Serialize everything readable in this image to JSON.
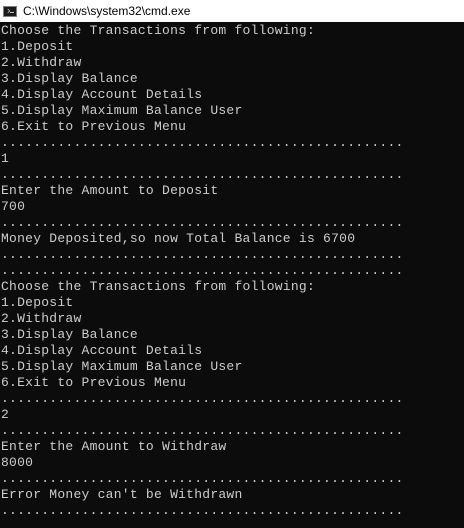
{
  "window": {
    "title": "C:\\Windows\\system32\\cmd.exe",
    "icon": "cmd-icon"
  },
  "console": {
    "lines": [
      "Choose the Transactions from following:",
      "1.Deposit",
      "2.Withdraw",
      "3.Display Balance",
      "4.Display Account Details",
      "5.Display Maximum Balance User",
      "6.Exit to Previous Menu",
      "..................................................",
      "1",
      "..................................................",
      "Enter the Amount to Deposit",
      "700",
      "..................................................",
      "Money Deposited,so now Total Balance is 6700",
      "..................................................",
      "..................................................",
      "Choose the Transactions from following:",
      "1.Deposit",
      "2.Withdraw",
      "3.Display Balance",
      "4.Display Account Details",
      "5.Display Maximum Balance User",
      "6.Exit to Previous Menu",
      "..................................................",
      "2",
      "..................................................",
      "Enter the Amount to Withdraw",
      "8000",
      "..................................................",
      "Error Money can't be Withdrawn",
      ".................................................."
    ]
  },
  "colors": {
    "console_background": "#0c0c0c",
    "console_text": "#cccccc",
    "titlebar_background": "#ffffff"
  }
}
